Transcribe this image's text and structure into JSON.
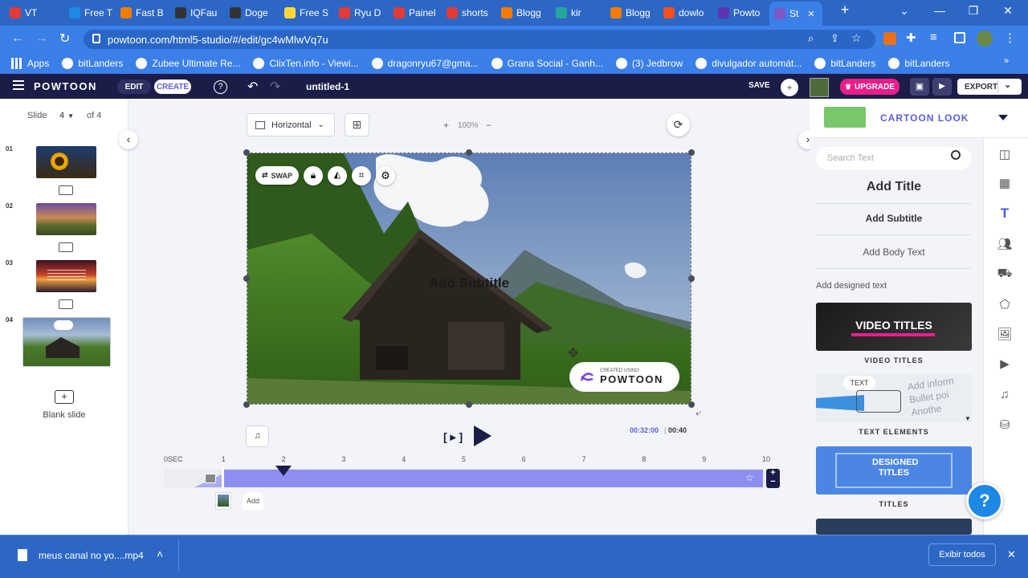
{
  "browser": {
    "tabs": [
      {
        "label": "VT",
        "fav_color": "#e53935"
      },
      {
        "label": "Free T",
        "fav_color": "#1e88e5"
      },
      {
        "label": "Fast B",
        "fav_color": "#f57c00"
      },
      {
        "label": "IQFau",
        "fav_color": "#333333"
      },
      {
        "label": "Doge",
        "fav_color": "#333333"
      },
      {
        "label": "Free S",
        "fav_color": "#fdd835"
      },
      {
        "label": "Ryu D",
        "fav_color": "#e53935"
      },
      {
        "label": "Painel",
        "fav_color": "#e53935"
      },
      {
        "label": "shorts",
        "fav_color": "#e53935"
      },
      {
        "label": "Blogg",
        "fav_color": "#f57c00"
      },
      {
        "label": "kir",
        "fav_color": "#26a69a"
      },
      {
        "label": "Blogg",
        "fav_color": "#f57c00"
      },
      {
        "label": "dowlo",
        "fav_color": "#f4511e"
      },
      {
        "label": "Powto",
        "fav_color": "#5e35b1"
      },
      {
        "label": "St",
        "fav_color": "#7e57c2"
      }
    ],
    "url": "powtoon.com/html5-studio/#/edit/gc4wMlwVq7u",
    "bookmarks": [
      "Apps",
      "bitLanders",
      "Zubee Ultimate Re...",
      "ClixTen.info - Viewi...",
      "dragonryu67@gma...",
      "Grana Social - Ganh...",
      "(3) Jedbrow",
      "divulgador automát...",
      "bitLanders",
      "bitLanders"
    ]
  },
  "app": {
    "logo": "POWTOON",
    "edit_label": "EDIT",
    "create_label": "CREATE",
    "help_glyph": "?",
    "doc_title": "untitled-1",
    "save_label": "SAVE",
    "upgrade_label": "UPGRADE",
    "export_label": "EXPORT",
    "accent": "#8c8ff0",
    "upgrade_color": "#e91e8c"
  },
  "slides": {
    "slide_label": "Slide",
    "current": "4",
    "of_label": "of 4",
    "numbers": [
      "01",
      "02",
      "03",
      "04"
    ],
    "blank_label": "Blank slide"
  },
  "canvas": {
    "orientation": "Horizontal",
    "zoom": "100%",
    "swap_label": "SWAP",
    "subtitle_text": "Add Subtitle",
    "watermark_small": "CREATED USING",
    "watermark_big": "POWTOON"
  },
  "player": {
    "frame_btn": "[ ▸ ]",
    "time_current": "00:32:00",
    "time_total": "00:40"
  },
  "timeline": {
    "ticks": [
      "0SEC",
      "1",
      "2",
      "3",
      "4",
      "5",
      "6",
      "7",
      "8",
      "9",
      "10"
    ],
    "add_label": "Add"
  },
  "right_panel": {
    "category": "CARTOON LOOK",
    "search_placeholder": "Search Text",
    "add_title": "Add Title",
    "add_subtitle": "Add Subtitle",
    "add_body": "Add Body Text",
    "designed_label": "Add designed text",
    "cards": [
      {
        "banner": "VIDEO TITLES",
        "label": "VIDEO TITLES"
      },
      {
        "banner": "TEXT",
        "label": "TEXT ELEMENTS"
      },
      {
        "banner": "DESIGNED TITLES",
        "label": "TITLES"
      }
    ],
    "text_element_lines": [
      "Add inform",
      "Bullet poi",
      "Anothe"
    ]
  },
  "help_button": "?",
  "downloads": {
    "file": "meus canal no yo....mp4",
    "show_all": "Exibir todos"
  }
}
